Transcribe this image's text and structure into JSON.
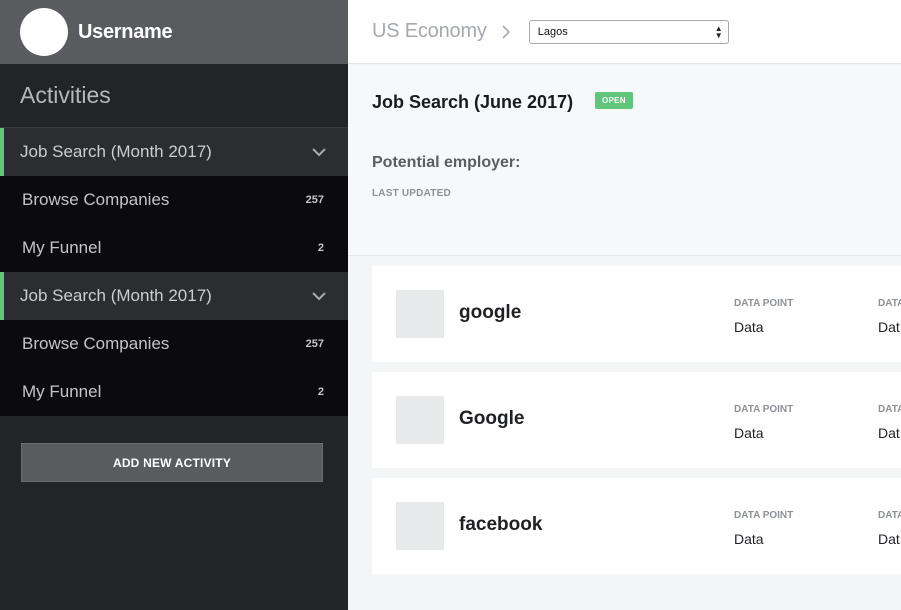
{
  "user": {
    "name": "Username"
  },
  "sidebar": {
    "title": "Activities",
    "groups": [
      {
        "label": "Job Search (Month 2017)",
        "items": [
          {
            "label": "Browse Companies",
            "count": "257"
          },
          {
            "label": "My Funnel",
            "count": "2"
          }
        ]
      },
      {
        "label": "Job Search (Month 2017)",
        "items": [
          {
            "label": "Browse Companies",
            "count": "257"
          },
          {
            "label": "My Funnel",
            "count": "2"
          }
        ]
      }
    ],
    "add_button_label": "ADD NEW ACTIVITY"
  },
  "topbar": {
    "breadcrumb": "US Economy",
    "location_select": {
      "selected": "Lagos"
    }
  },
  "detail": {
    "title": "Job Search (June 2017)",
    "status": "OPEN",
    "employer_label": "Potential employer:",
    "last_updated_label": "LAST UPDATED"
  },
  "cards": [
    {
      "company": "google",
      "data_points": [
        {
          "label": "DATA POINT",
          "value": "Data"
        },
        {
          "label": "DATA",
          "value": "Dat"
        }
      ]
    },
    {
      "company": "Google",
      "data_points": [
        {
          "label": "DATA POINT",
          "value": "Data"
        },
        {
          "label": "DATA",
          "value": "Dat"
        }
      ]
    },
    {
      "company": "facebook",
      "data_points": [
        {
          "label": "DATA POINT",
          "value": "Data"
        },
        {
          "label": "DATA",
          "value": "Dat"
        }
      ]
    }
  ],
  "colors": {
    "accent": "#5fc67a",
    "sidebar_bg": "#232427",
    "submenu_bg": "#0b0b0d"
  }
}
